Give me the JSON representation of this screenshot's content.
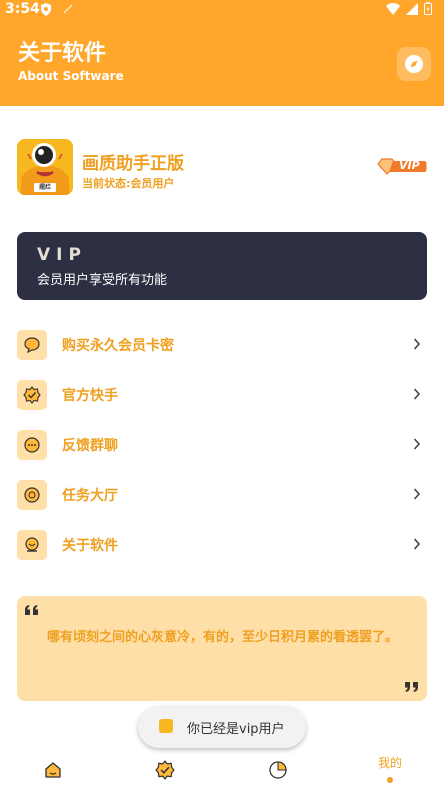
{
  "status_bar": {
    "time": "3:54"
  },
  "header": {
    "title": "关于软件",
    "subtitle": "About Software"
  },
  "app": {
    "name": "画质助手正版",
    "status": "当前状态:会员用户",
    "logo_text": "摆烂",
    "badge_text": "VIP"
  },
  "vip_card": {
    "title": "VIP",
    "description": "会员用户享受所有功能"
  },
  "menu": {
    "items": [
      {
        "label": "购买永久会员卡密",
        "icon": "chat-bubble-icon"
      },
      {
        "label": "官方快手",
        "icon": "badge-check-icon"
      },
      {
        "label": "反馈群聊",
        "icon": "chat-dots-icon"
      },
      {
        "label": "任务大厅",
        "icon": "circle-icon"
      },
      {
        "label": "关于软件",
        "icon": "bell-icon"
      }
    ]
  },
  "quote": {
    "text": "哪有顷刻之间的心灰意冷，有的，至少日积月累的看透罢了。"
  },
  "toast": {
    "text": "你已经是vip用户"
  },
  "bottom_nav": {
    "items": [
      {
        "name": "home",
        "icon": "home-icon"
      },
      {
        "name": "discover",
        "icon": "badge-check-icon"
      },
      {
        "name": "stats",
        "icon": "pie-chart-icon"
      },
      {
        "name": "mine",
        "label": "我的",
        "active": true
      }
    ]
  },
  "colors": {
    "accent": "#FFA62B",
    "text_accent": "#F0A020",
    "card_dark": "#2D2F42",
    "icon_bg": "#FFE0A8",
    "quote_bg": "#FFDFA8"
  }
}
